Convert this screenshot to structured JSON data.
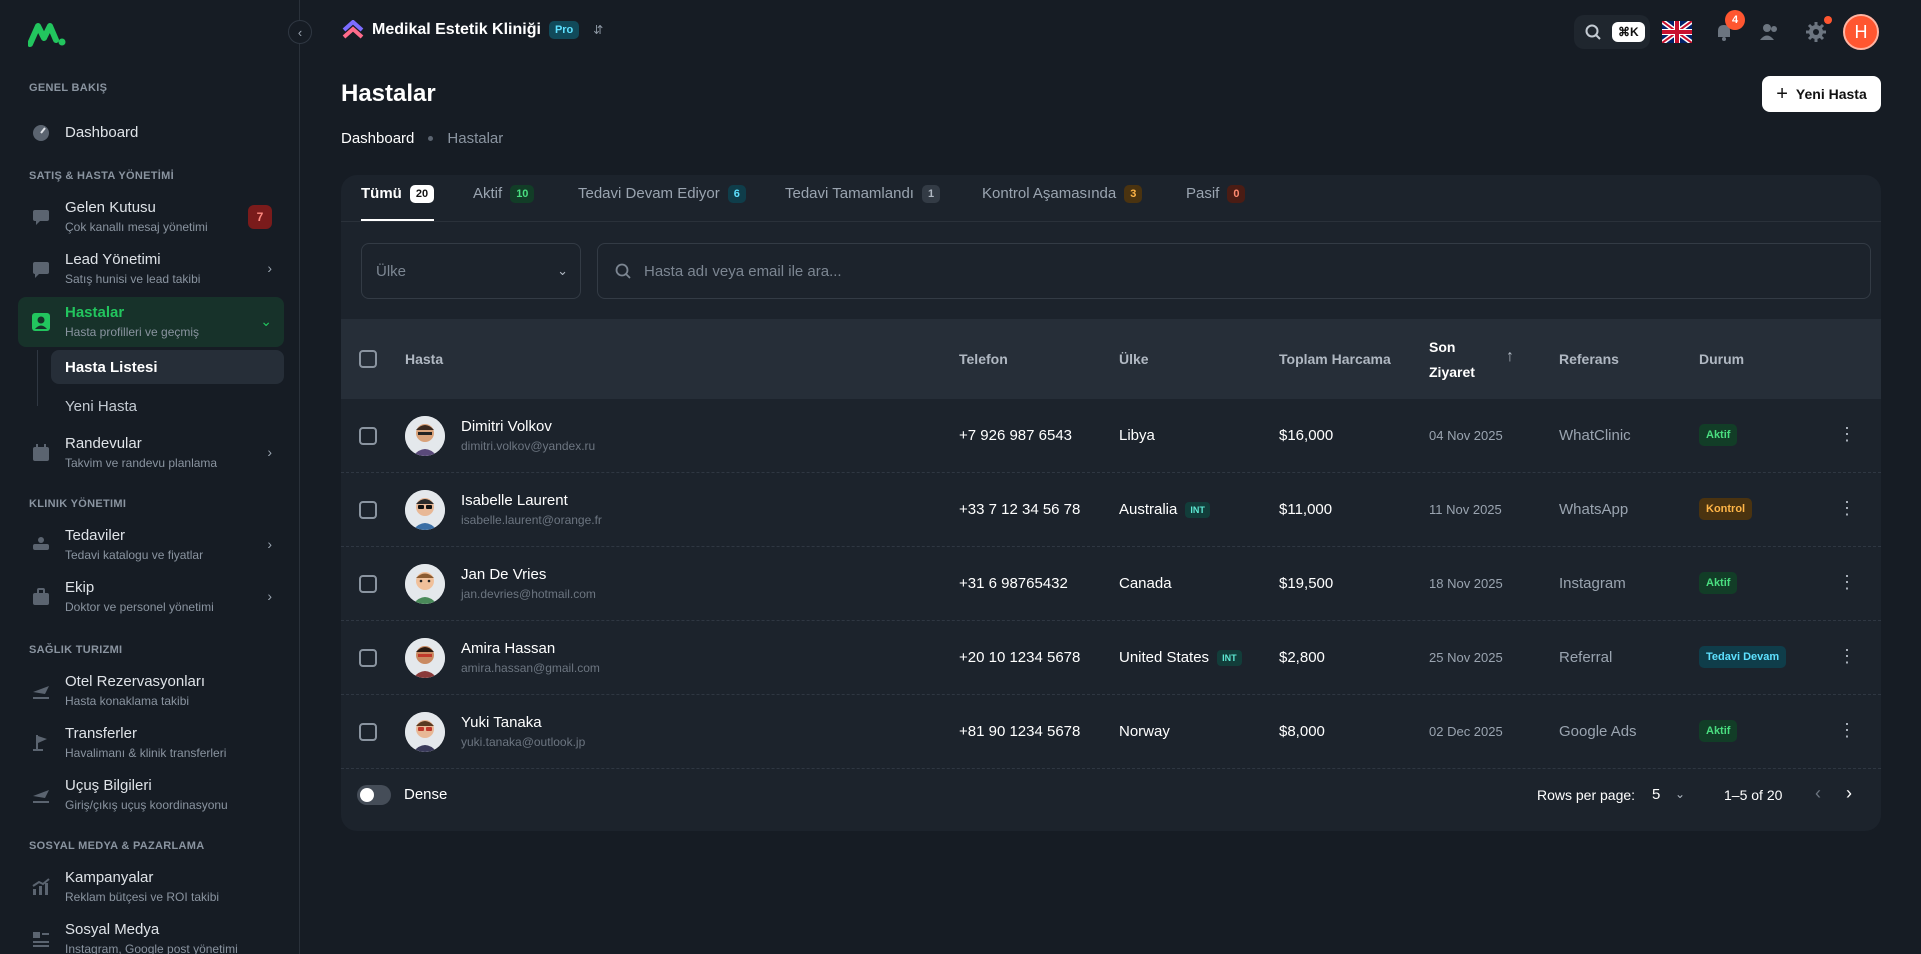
{
  "sidebar": {
    "sections": {
      "overview": "GENEL BAKIŞ",
      "sales": "SATIŞ & HASTA YÖNETİMİ",
      "clinic": "KLINIK YÖNETIMI",
      "tourism": "SAĞLIK TURIZMI",
      "social": "SOSYAL MEDYA & PAZARLAMA"
    },
    "dashboard": "Dashboard",
    "inbox": {
      "label": "Gelen Kutusu",
      "sub": "Çok kanallı mesaj yönetimi",
      "badge": "7"
    },
    "lead": {
      "label": "Lead Yönetimi",
      "sub": "Satış hunisi ve lead takibi"
    },
    "patients": {
      "label": "Hastalar",
      "sub": "Hasta profilleri ve geçmiş"
    },
    "patient_list": "Hasta Listesi",
    "new_patient": "Yeni Hasta",
    "appointments": {
      "label": "Randevular",
      "sub": "Takvim ve randevu planlama"
    },
    "treatments": {
      "label": "Tedaviler",
      "sub": "Tedavi katalogu ve fiyatlar"
    },
    "team": {
      "label": "Ekip",
      "sub": "Doktor ve personel yönetimi"
    },
    "hotels": {
      "label": "Otel Rezervasyonları",
      "sub": "Hasta konaklama takibi"
    },
    "transfers": {
      "label": "Transferler",
      "sub": "Havalimanı & klinik transferleri"
    },
    "flights": {
      "label": "Uçuş Bilgileri",
      "sub": "Giriş/çıkış uçuş koordinasyonu"
    },
    "campaigns": {
      "label": "Kampanyalar",
      "sub": "Reklam bütçesi ve ROI takibi"
    },
    "social": {
      "label": "Sosyal Medya",
      "sub": "Instagram, Google post yönetimi"
    }
  },
  "topbar": {
    "clinic_name": "Medikal Estetik Kliniği",
    "plan": "Pro",
    "shortcut": "⌘K",
    "notifications": "4",
    "avatar_letter": "H"
  },
  "page": {
    "title": "Hastalar",
    "breadcrumb": [
      "Dashboard",
      "Hastalar"
    ],
    "new_button": "Yeni Hasta"
  },
  "tabs": [
    {
      "label": "Tümü",
      "count": "20"
    },
    {
      "label": "Aktif",
      "count": "10"
    },
    {
      "label": "Tedavi Devam Ediyor",
      "count": "6"
    },
    {
      "label": "Tedavi Tamamlandı",
      "count": "1"
    },
    {
      "label": "Kontrol Aşamasında",
      "count": "3"
    },
    {
      "label": "Pasif",
      "count": "0"
    }
  ],
  "filters": {
    "country_placeholder": "Ülke",
    "search_placeholder": "Hasta adı veya email ile ara..."
  },
  "table": {
    "headers": {
      "patient": "Hasta",
      "phone": "Telefon",
      "country": "Ülke",
      "total": "Toplam Harcama",
      "last_visit_1": "Son",
      "last_visit_2": "Ziyaret",
      "referral": "Referans",
      "status": "Durum"
    },
    "rows": [
      {
        "name": "Dimitri Volkov",
        "email": "dimitri.volkov@yandex.ru",
        "phone": "+7 926 987 6543",
        "country": "Libya",
        "int": "",
        "total": "$16,000",
        "date": "04 Nov 2025",
        "ref": "WhatClinic",
        "status": "Aktif"
      },
      {
        "name": "Isabelle Laurent",
        "email": "isabelle.laurent@orange.fr",
        "phone": "+33 7 12 34 56 78",
        "country": "Australia",
        "int": "INT",
        "total": "$11,000",
        "date": "11 Nov 2025",
        "ref": "WhatsApp",
        "status": "Kontrol"
      },
      {
        "name": "Jan De Vries",
        "email": "jan.devries@hotmail.com",
        "phone": "+31 6 98765432",
        "country": "Canada",
        "int": "",
        "total": "$19,500",
        "date": "18 Nov 2025",
        "ref": "Instagram",
        "status": "Aktif"
      },
      {
        "name": "Amira Hassan",
        "email": "amira.hassan@gmail.com",
        "phone": "+20 10 1234 5678",
        "country": "United States",
        "int": "INT",
        "total": "$2,800",
        "date": "25 Nov 2025",
        "ref": "Referral",
        "status": "Tedavi Devam"
      },
      {
        "name": "Yuki Tanaka",
        "email": "yuki.tanaka@outlook.jp",
        "phone": "+81 90 1234 5678",
        "country": "Norway",
        "int": "",
        "total": "$8,000",
        "date": "02 Dec 2025",
        "ref": "Google Ads",
        "status": "Aktif"
      }
    ]
  },
  "footer": {
    "dense": "Dense",
    "rows_per_page_label": "Rows per page:",
    "rows_per_page": "5",
    "range": "1–5 of 20"
  },
  "colors": {
    "accent": "#22c55e",
    "background": "#161c24",
    "card": "#1c232c"
  }
}
